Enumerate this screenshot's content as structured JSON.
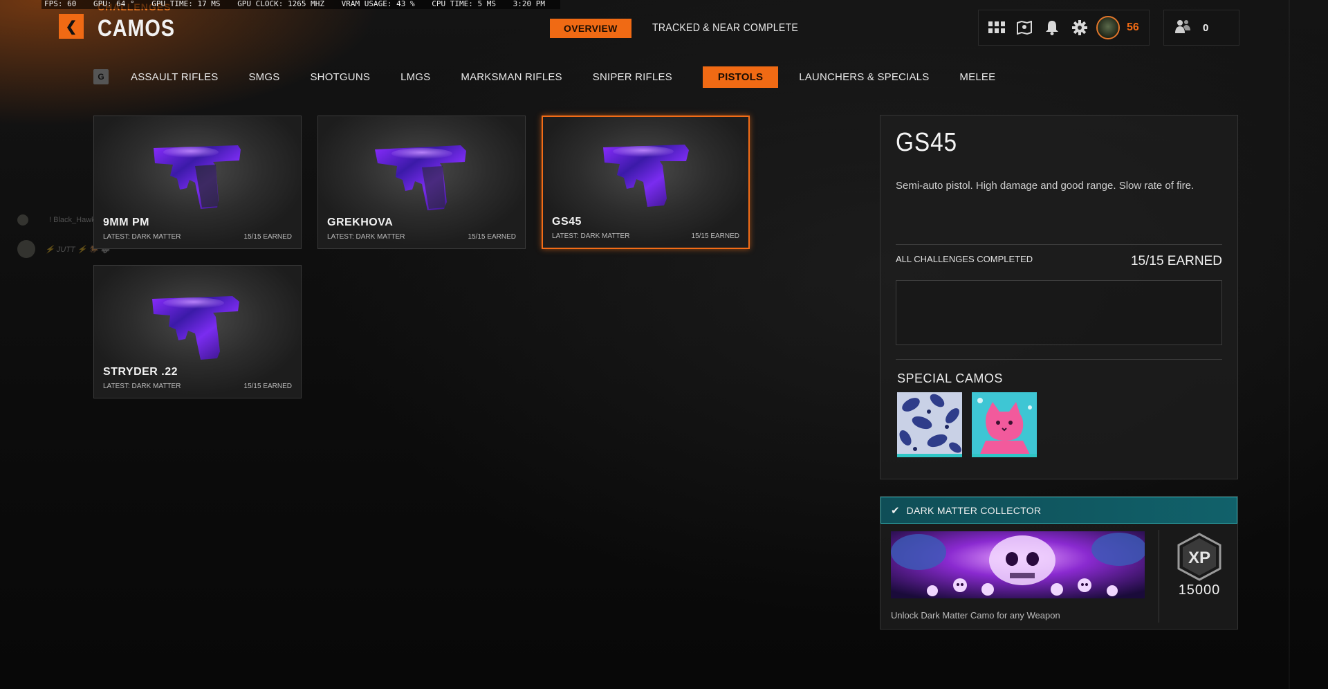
{
  "perf": {
    "fps": "FPS:  60",
    "gpu": "GPU:  64 °",
    "gpu_time": "GPU TIME:  17 MS",
    "gpu_clock": "GPU CLOCK:  1265 MHZ",
    "vram": "VRAM USAGE:  43 %",
    "cpu_time": "CPU TIME:   5 MS",
    "clock": "3:20 PM"
  },
  "header": {
    "breadcrumb": "CHALLENGES",
    "title": "CAMOS",
    "tabs": [
      {
        "label": "OVERVIEW",
        "active": true
      },
      {
        "label": "TRACKED & NEAR COMPLETE",
        "active": false
      }
    ],
    "player_level": "56",
    "friends_count": "0",
    "icons": [
      "grid-icon",
      "map-icon",
      "bell-icon",
      "gear-icon"
    ]
  },
  "categories": {
    "key_hint": "G",
    "items": [
      {
        "label": "ASSAULT RIFLES",
        "active": false
      },
      {
        "label": "SMGS",
        "active": false
      },
      {
        "label": "SHOTGUNS",
        "active": false
      },
      {
        "label": "LMGS",
        "active": false
      },
      {
        "label": "MARKSMAN RIFLES",
        "active": false
      },
      {
        "label": "SNIPER RIFLES",
        "active": false
      },
      {
        "label": "PISTOLS",
        "active": true
      },
      {
        "label": "LAUNCHERS & SPECIALS",
        "active": false
      },
      {
        "label": "MELEE",
        "active": false
      }
    ]
  },
  "weapons": [
    {
      "name": "9MM PM",
      "latest": "LATEST: DARK MATTER",
      "earned": "15/15 EARNED",
      "selected": false
    },
    {
      "name": "GREKHOVA",
      "latest": "LATEST: DARK MATTER",
      "earned": "15/15 EARNED",
      "selected": false
    },
    {
      "name": "GS45",
      "latest": "LATEST: DARK MATTER",
      "earned": "15/15 EARNED",
      "selected": true
    },
    {
      "name": "STRYDER .22",
      "latest": "LATEST: DARK MATTER",
      "earned": "15/15 EARNED",
      "selected": false
    }
  ],
  "chat_ghost": [
    {
      "text": "! Black_Hawk"
    },
    {
      "text": "⚡ JUTT ⚡ 🐎 🐺"
    }
  ],
  "detail": {
    "title": "GS45",
    "description": "Semi-auto pistol.  High damage and good range. Slow rate of fire.",
    "challenges_label": "ALL CHALLENGES COMPLETED",
    "challenges_earned": "15/15 EARNED",
    "special_camos_label": "SPECIAL CAMOS"
  },
  "collector": {
    "title": "DARK MATTER COLLECTOR",
    "xp_value": "15000",
    "unlock_text": "Unlock Dark Matter Camo for any Weapon",
    "accent": "#2fc6c6"
  },
  "colors": {
    "accent_orange": "#f06a14",
    "teal": "#11616a",
    "background": "#0d0d0d"
  }
}
